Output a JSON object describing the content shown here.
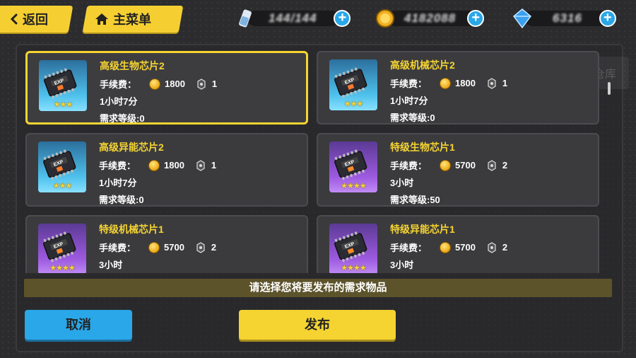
{
  "header": {
    "back_label": "返回",
    "home_label": "主菜单",
    "resources": [
      {
        "icon": "stamina-bottle-icon",
        "value": "144/144"
      },
      {
        "icon": "gold-coin-icon",
        "value": "4182088"
      },
      {
        "icon": "blue-crystal-icon",
        "value": "6316"
      }
    ]
  },
  "background_hint": "保级仓库",
  "items": [
    {
      "name": "高级生物芯片2",
      "fee_label": "手续费：",
      "fee": "1800",
      "chip_count": "1",
      "duration": "1小时7分",
      "level": "需求等级:0",
      "stars": "★★★",
      "theme": "blue",
      "selected": true
    },
    {
      "name": "高级机械芯片2",
      "fee_label": "手续费：",
      "fee": "1800",
      "chip_count": "1",
      "duration": "1小时7分",
      "level": "需求等级:0",
      "stars": "★★★",
      "theme": "blue",
      "selected": false
    },
    {
      "name": "高级异能芯片2",
      "fee_label": "手续费：",
      "fee": "1800",
      "chip_count": "1",
      "duration": "1小时7分",
      "level": "需求等级:0",
      "stars": "★★★",
      "theme": "blue",
      "selected": false
    },
    {
      "name": "特级生物芯片1",
      "fee_label": "手续费：",
      "fee": "5700",
      "chip_count": "2",
      "duration": "3小时",
      "level": "需求等级:50",
      "stars": "★★★★",
      "theme": "purple",
      "selected": false
    },
    {
      "name": "特级机械芯片1",
      "fee_label": "手续费：",
      "fee": "5700",
      "chip_count": "2",
      "duration": "3小时",
      "level": "",
      "stars": "★★★★",
      "theme": "purple",
      "selected": false
    },
    {
      "name": "特级异能芯片1",
      "fee_label": "手续费：",
      "fee": "5700",
      "chip_count": "2",
      "duration": "3小时",
      "level": "",
      "stars": "★★★★",
      "theme": "purple",
      "selected": false
    }
  ],
  "hint": "请选择您将要发布的需求物品",
  "buttons": {
    "cancel": "取消",
    "publish": "发布"
  },
  "colors": {
    "accent_yellow": "#f5d432",
    "accent_blue": "#2aa7e8"
  }
}
